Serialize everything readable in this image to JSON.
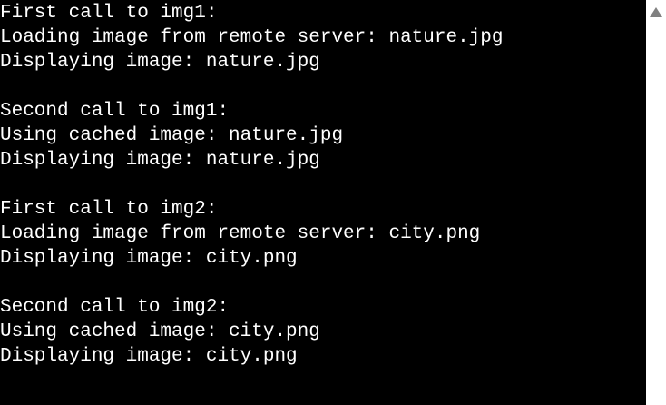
{
  "console": {
    "lines": [
      "First call to img1:",
      "Loading image from remote server: nature.jpg",
      "Displaying image: nature.jpg",
      "",
      "Second call to img1:",
      "Using cached image: nature.jpg",
      "Displaying image: nature.jpg",
      "",
      "First call to img2:",
      "Loading image from remote server: city.png",
      "Displaying image: city.png",
      "",
      "Second call to img2:",
      "Using cached image: city.png",
      "Displaying image: city.png"
    ]
  },
  "scrollbar": {
    "up_icon": "triangle-up-icon",
    "arrow_color": "#808080"
  },
  "colors": {
    "background": "#000000",
    "text": "#ffffff"
  }
}
